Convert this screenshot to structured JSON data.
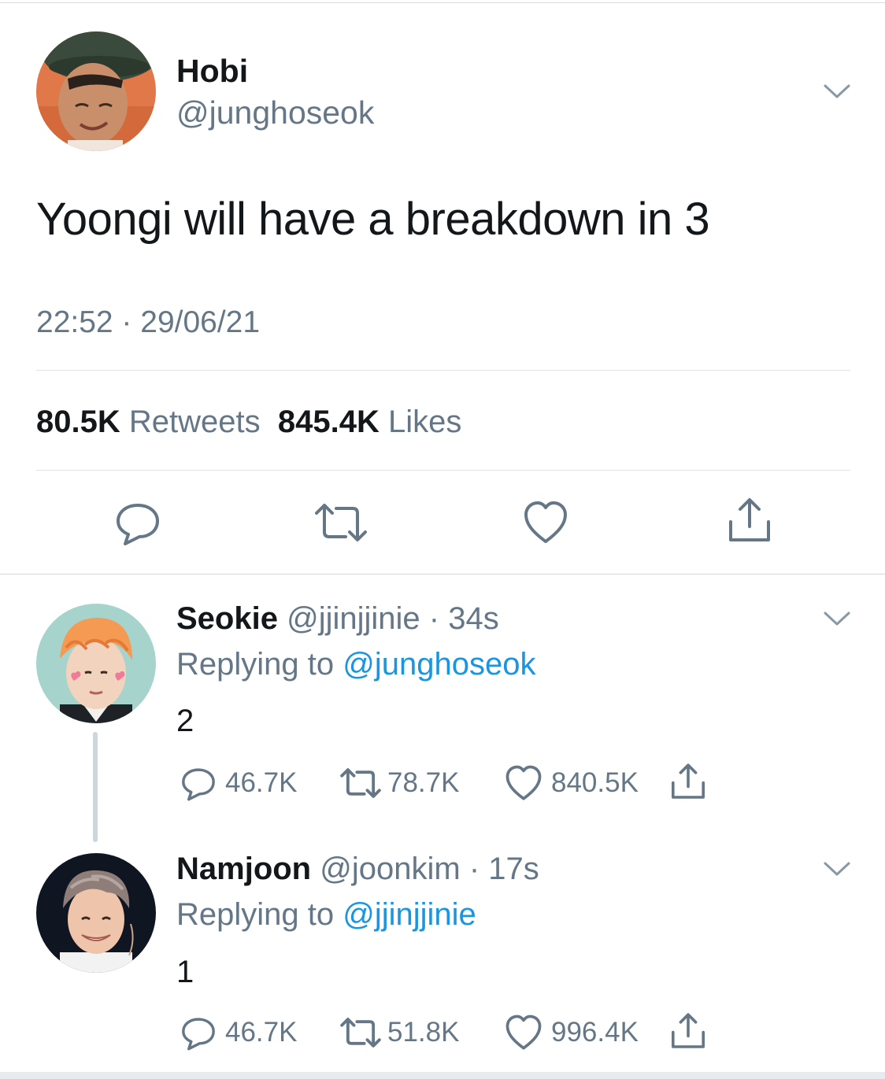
{
  "main_tweet": {
    "name": "Hobi",
    "handle": "@junghoseok",
    "text": "Yoongi will have a breakdown in 3",
    "timestamp": "22:52 · 29/06/21",
    "retweets": {
      "count": "80.5K",
      "label": "Retweets"
    },
    "likes": {
      "count": "845.4K",
      "label": "Likes"
    },
    "menu_icon": "chevron-down-icon",
    "actions": [
      "reply-icon",
      "retweet-icon",
      "like-icon",
      "share-icon"
    ]
  },
  "replies": [
    {
      "name": "Seokie",
      "handle": "@jjinjjinie",
      "time": "· 34s",
      "replying_prefix": "Replying to",
      "replying_to": "@junghoseok",
      "text": "2",
      "reply_count": "46.7K",
      "retweet_count": "78.7K",
      "like_count": "840.5K"
    },
    {
      "name": "Namjoon",
      "handle": "@joonkim",
      "time": "· 17s",
      "replying_prefix": "Replying to",
      "replying_to": "@jjinjjinie",
      "text": "1",
      "reply_count": "46.7K",
      "retweet_count": "51.8K",
      "like_count": "996.4K"
    }
  ],
  "colors": {
    "text": "#14171a",
    "secondary": "#657786",
    "link": "#1b95e0",
    "divider": "#dfe3e6",
    "icon": "#657786"
  }
}
